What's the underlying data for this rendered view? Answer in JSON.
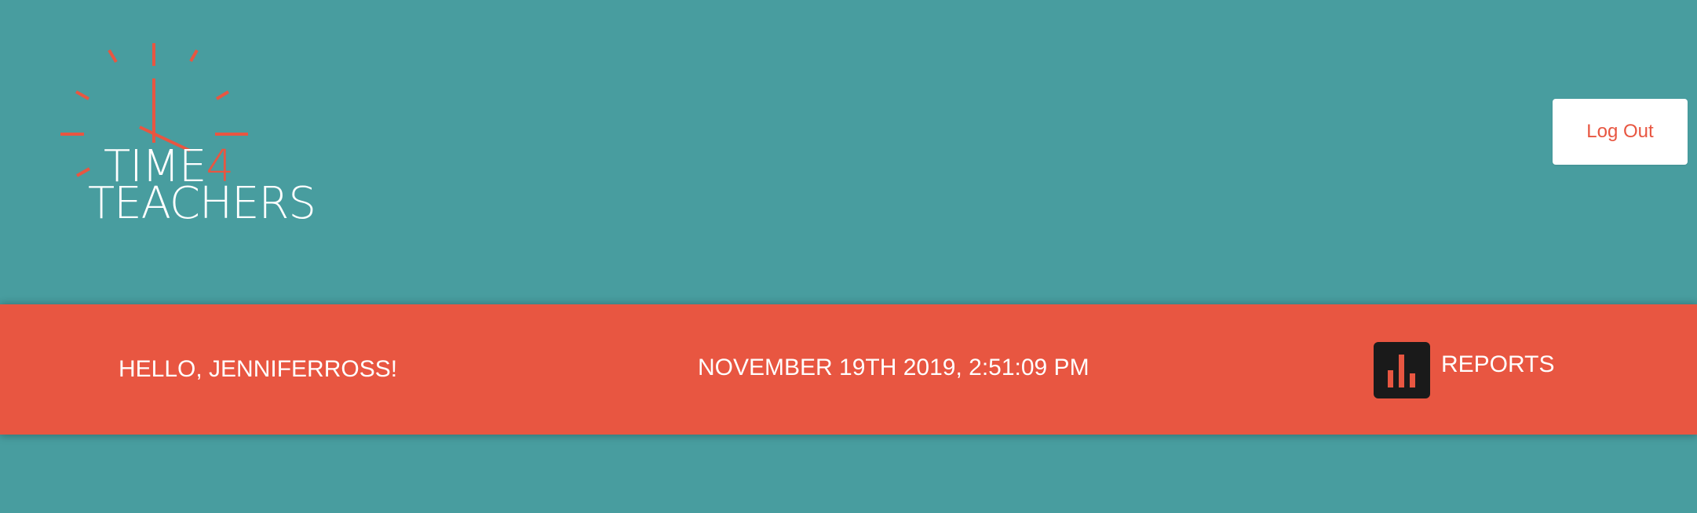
{
  "header": {
    "logo": {
      "line1": "TIME",
      "line1_accent": "4",
      "line2": "TEACHERS",
      "icon": "clock-icon"
    },
    "logout_label": "Log Out"
  },
  "nav": {
    "greeting": "HELLO, JENNIFERROSS!",
    "datetime": "NOVEMBER 19TH 2019, 2:51:09 PM",
    "reports": {
      "label": "REPORTS",
      "icon": "bar-chart-icon"
    }
  },
  "colors": {
    "background": "#489d9f",
    "accent": "#e85641",
    "button_bg": "#ffffff",
    "icon_tile": "#1a1a1a"
  }
}
